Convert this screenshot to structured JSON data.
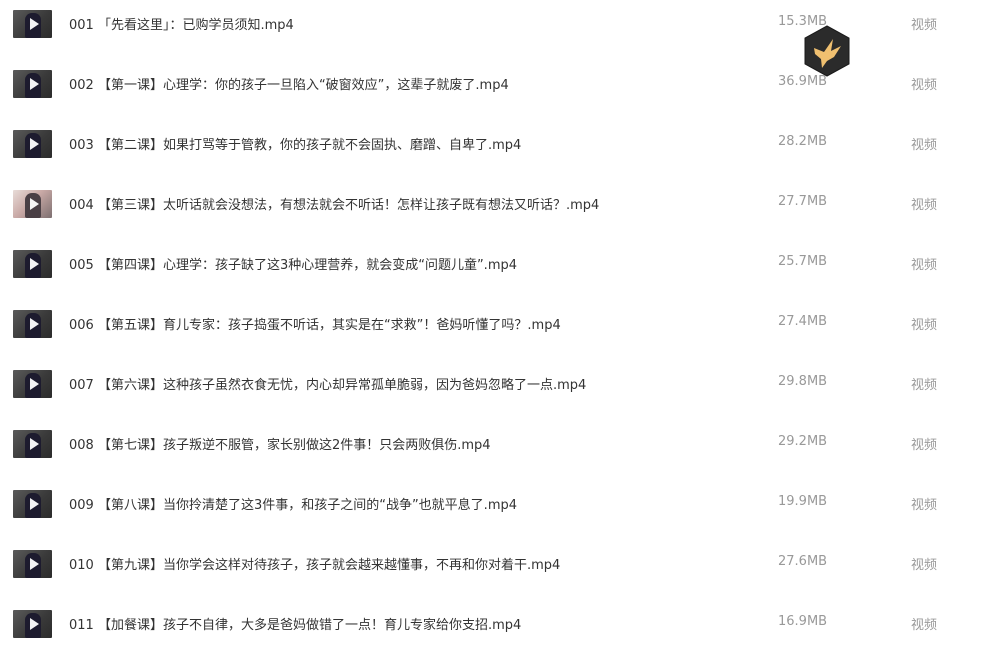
{
  "files": [
    {
      "name": "001 「先看这里」：已购学员须知.mp4",
      "size": "15.3MB",
      "type": "视频",
      "thumb_style": "dark"
    },
    {
      "name": "002 【第一课】心理学：你的孩子一旦陷入“破窗效应”，这辈子就废了.mp4",
      "size": "36.9MB",
      "type": "视频",
      "thumb_style": "dark"
    },
    {
      "name": "003 【第二课】如果打骂等于管教，你的孩子就不会固执、磨蹭、自卑了.mp4",
      "size": "28.2MB",
      "type": "视频",
      "thumb_style": "dark"
    },
    {
      "name": "004 【第三课】太听话就会没想法，有想法就会不听话！怎样让孩子既有想法又听话？.mp4",
      "size": "27.7MB",
      "type": "视频",
      "thumb_style": "light"
    },
    {
      "name": "005 【第四课】心理学：孩子缺了这3种心理营养，就会变成“问题儿童”.mp4",
      "size": "25.7MB",
      "type": "视频",
      "thumb_style": "dark"
    },
    {
      "name": "006 【第五课】育儿专家：孩子捣蛋不听话，其实是在“求救”！爸妈听懂了吗？.mp4",
      "size": "27.4MB",
      "type": "视频",
      "thumb_style": "dark"
    },
    {
      "name": "007 【第六课】这种孩子虽然衣食无忧，内心却异常孤单脆弱，因为爸妈忽略了一点.mp4",
      "size": "29.8MB",
      "type": "视频",
      "thumb_style": "dark"
    },
    {
      "name": "008 【第七课】孩子叛逆不服管，家长别做这2件事！只会两败俱伤.mp4",
      "size": "29.2MB",
      "type": "视频",
      "thumb_style": "dark"
    },
    {
      "name": "009 【第八课】当你拎清楚了这3件事，和孩子之间的“战争”也就平息了.mp4",
      "size": "19.9MB",
      "type": "视频",
      "thumb_style": "dark"
    },
    {
      "name": "010 【第九课】当你学会这样对待孩子，孩子就会越来越懂事，不再和你对着干.mp4",
      "size": "27.6MB",
      "type": "视频",
      "thumb_style": "dark"
    },
    {
      "name": "011 【加餐课】孩子不自律，大多是爸妈做错了一点！育儿专家给你支招.mp4",
      "size": "16.9MB",
      "type": "视频",
      "thumb_style": "dark"
    }
  ],
  "badge": {
    "icon": "bird-logo-icon",
    "bg_color": "#2b2b2b",
    "bird_color": "#f0c070"
  },
  "colors": {
    "name_text": "#333333",
    "meta_text": "#999999"
  }
}
